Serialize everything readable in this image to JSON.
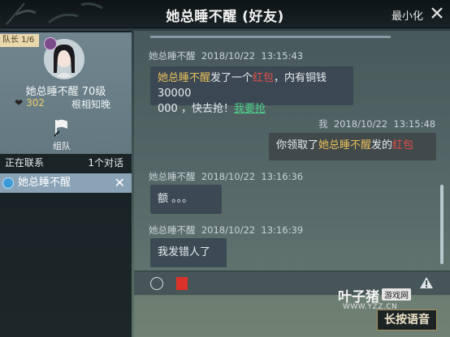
{
  "window": {
    "title": "她总睡不醒 (好友)",
    "minimize_label": "最小化"
  },
  "profile": {
    "leader_label": "队长 1/6",
    "name_level": "她总睡不醒  70级",
    "intimacy": "302",
    "relation": "根相知晚",
    "team_label": "组队"
  },
  "contacts": {
    "header_left": "正在联系",
    "header_right": "1个对话",
    "items": [
      {
        "name": "她总睡不醒"
      }
    ]
  },
  "messages": [
    {
      "sender": "她总睡不醒",
      "date": "2018/10/22",
      "time": "13:15:43",
      "parts": {
        "name": "她总睡不醒",
        "t1": "发了一个",
        "redpack": "红包",
        "t2": "，内有铜钱30000",
        "line2": "000 ，快去抢！",
        "link": "我要抢"
      }
    },
    {
      "sender": "我",
      "date": "2018/10/22",
      "time": "13:15:48",
      "parts": {
        "t1": "你领取了",
        "name": "她总睡不醒",
        "t2": "发的",
        "redpack": "红包"
      }
    },
    {
      "sender": "她总睡不醒",
      "date": "2018/10/22",
      "time": "13:16:36",
      "text": "额 。。。"
    },
    {
      "sender": "她总睡不醒",
      "date": "2018/10/22",
      "time": "13:16:39",
      "text": "我发错人了"
    }
  ],
  "input": {
    "voice_label": "长按语音"
  },
  "watermark": {
    "main": "叶子猪",
    "tag": "游戏网",
    "url": "WWW.YZZ.CN"
  },
  "colors": {
    "gold_name": "#e8bf5a",
    "redpack": "#e5504a",
    "link": "#4fd28a",
    "contact_selected": "#8aa3b6"
  }
}
